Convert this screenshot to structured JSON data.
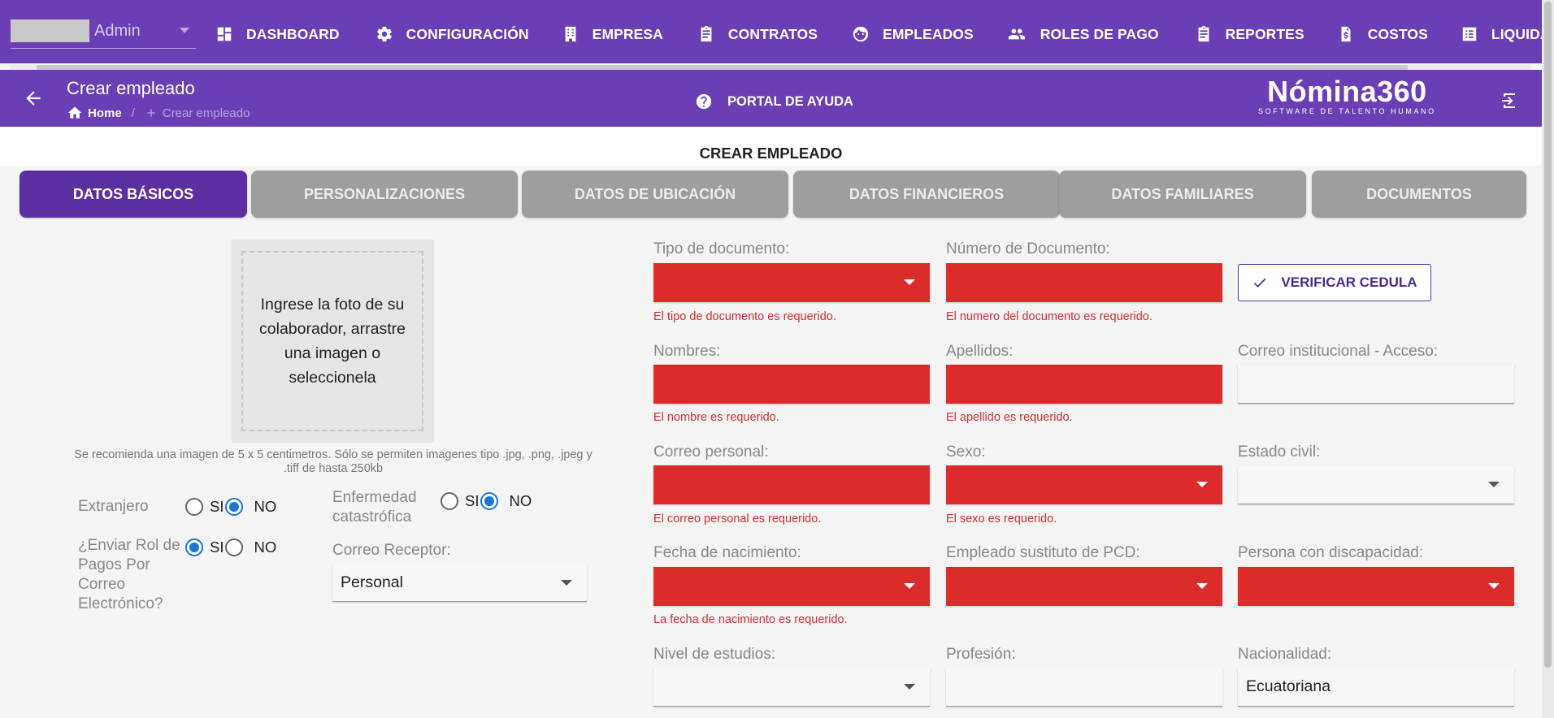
{
  "nav": {
    "user_name": "Admin",
    "items": [
      {
        "label": "DASHBOARD",
        "icon": "dashboard-icon"
      },
      {
        "label": "CONFIGURACIÓN",
        "icon": "gear-icon"
      },
      {
        "label": "EMPRESA",
        "icon": "building-icon"
      },
      {
        "label": "CONTRATOS",
        "icon": "clipboard-icon"
      },
      {
        "label": "EMPLEADOS",
        "icon": "face-icon"
      },
      {
        "label": "ROLES DE PAGO",
        "icon": "people-icon"
      },
      {
        "label": "REPORTES",
        "icon": "clipboard-icon"
      },
      {
        "label": "COSTOS",
        "icon": "dollar-file-icon"
      },
      {
        "label": "LIQUIDACIONES",
        "icon": "list-icon"
      }
    ]
  },
  "header": {
    "title": "Crear empleado",
    "breadcrumb_home": "Home",
    "breadcrumb_sep": "/",
    "breadcrumb_current": "Crear empleado",
    "help_label": "PORTAL DE AYUDA",
    "brand_name": "Nómina360",
    "brand_tagline": "SOFTWARE DE TALENTO HUMANO"
  },
  "page_title": "CREAR EMPLEADO",
  "tabs": [
    {
      "label": "DATOS BÁSICOS",
      "active": true
    },
    {
      "label": "PERSONALIZACIONES",
      "active": false
    },
    {
      "label": "DATOS DE UBICACIÓN",
      "active": false
    },
    {
      "label": "DATOS FINANCIEROS",
      "active": false
    },
    {
      "label": "DATOS FAMILIARES",
      "active": false
    },
    {
      "label": "DOCUMENTOS",
      "active": false
    }
  ],
  "photo": {
    "prompt": "Ingrese la foto de su colaborador, arrastre una imagen o seleccionela",
    "hint": "Se recomienda una imagen de 5 x 5 centimetros. Sólo se permiten imagenes tipo .jpg, .png, .jpeg y .tiff de hasta 250kb"
  },
  "options": {
    "extranjero_label": "Extranjero",
    "enfermedad_label": "Enfermedad catastrófica",
    "enviar_rol_label": "¿Enviar Rol de Pagos Por Correo Electrónico?",
    "si": "SI",
    "no": "NO",
    "extranjero_value": "NO",
    "enfermedad_value": "NO",
    "enviar_rol_value": "SI",
    "correo_receptor_label": "Correo Receptor:",
    "correo_receptor_value": "Personal"
  },
  "form": {
    "tipo_doc": {
      "label": "Tipo de documento:",
      "error": "El tipo de documento es requerido."
    },
    "num_doc": {
      "label": "Número de Documento:",
      "error": "El numero del documento es requerido."
    },
    "verify_label": "VERIFICAR CEDULA",
    "nombres": {
      "label": "Nombres:",
      "error": "El nombre es requerido."
    },
    "apellidos": {
      "label": "Apellidos:",
      "error": "El apellido es requerido."
    },
    "correo_inst": {
      "label": "Correo institucional - Acceso:"
    },
    "correo_personal": {
      "label": "Correo personal:",
      "error": "El correo personal es requerido."
    },
    "sexo": {
      "label": "Sexo:",
      "error": "El sexo es requerido."
    },
    "estado_civil": {
      "label": "Estado civil:"
    },
    "fecha_nac": {
      "label": "Fecha de nacimiento:",
      "error": "La fecha de nacimiento es requerido."
    },
    "sustituto_pcd": {
      "label": "Empleado sustituto de PCD:"
    },
    "discapacidad": {
      "label": "Persona con discapacidad:"
    },
    "nivel_estudios": {
      "label": "Nivel de estudios:"
    },
    "profesion": {
      "label": "Profesión:"
    },
    "nacionalidad": {
      "label": "Nacionalidad:",
      "value": "Ecuatoriana"
    }
  },
  "colors": {
    "primary": "#6a3fb5",
    "active_tab": "#5c2fa0",
    "error": "#dc2b2b",
    "radio_on": "#1976d2"
  }
}
